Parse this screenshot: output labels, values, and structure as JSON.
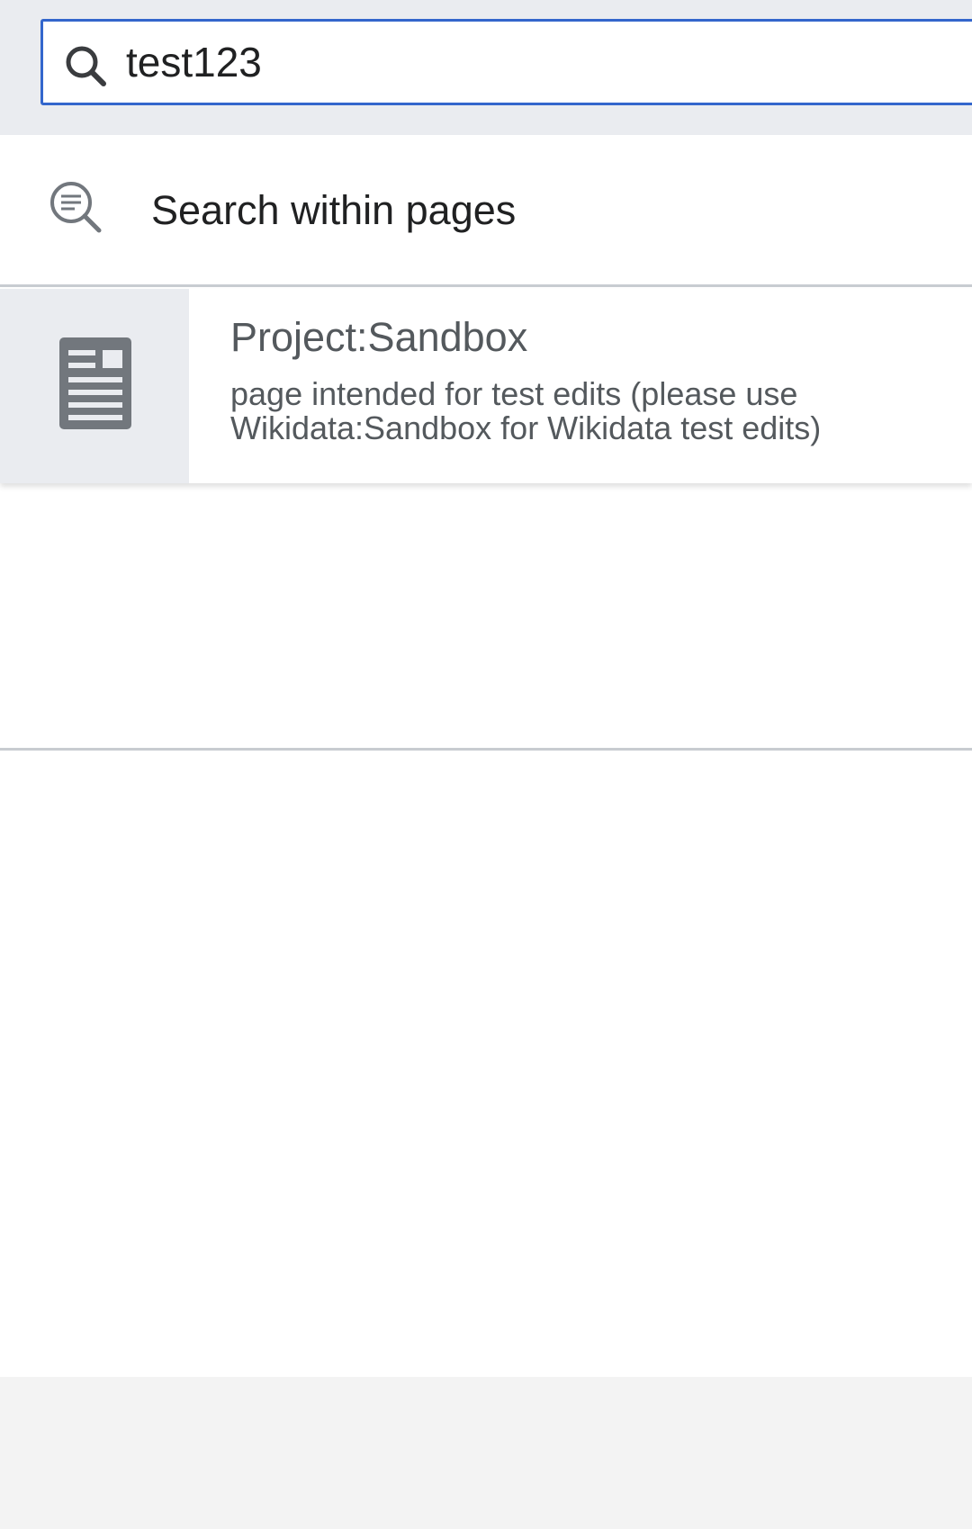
{
  "search": {
    "value": "test123",
    "icon": "search-icon"
  },
  "search_within": {
    "label": "Search within pages",
    "icon": "fulltext-search-icon"
  },
  "results": [
    {
      "title": "Project:Sandbox",
      "description": "page intended for test edits (please use Wikidata:Sandbox for Wikidata test edits)",
      "icon": "article-icon"
    }
  ],
  "colors": {
    "accent": "#3366cc",
    "header_bg": "#eaecf0",
    "text": "#202122",
    "muted_text": "#54595d"
  }
}
